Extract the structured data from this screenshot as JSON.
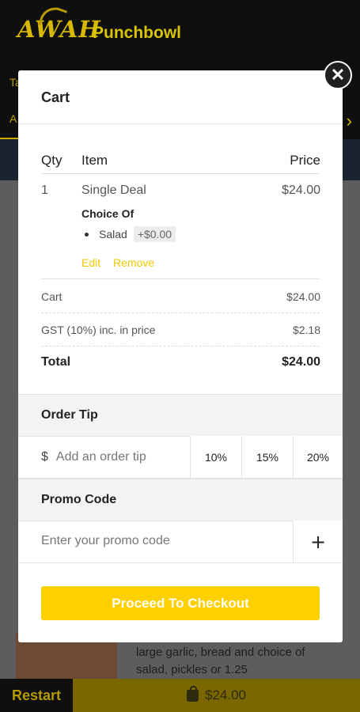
{
  "background": {
    "logo_text": "AWAH",
    "restaurant_name": "Punchbowl",
    "tab_1": "Ta",
    "tab_2": "A",
    "description": "large garlic, bread and choice of salad, pickles or 1.25",
    "restart_label": "Restart",
    "bottom_total": "$24.00"
  },
  "cart": {
    "title": "Cart",
    "columns": {
      "qty": "Qty",
      "item": "Item",
      "price": "Price"
    },
    "items": [
      {
        "qty": "1",
        "name": "Single Deal",
        "price": "$24.00",
        "choice_label": "Choice Of",
        "option": "Salad",
        "option_price": "+$0.00",
        "edit": "Edit",
        "remove": "Remove"
      }
    ],
    "summary": {
      "cart_label": "Cart",
      "cart_value": "$24.00",
      "gst_label": "GST (10%) inc. in price",
      "gst_value": "$2.18",
      "total_label": "Total",
      "total_value": "$24.00"
    },
    "tip": {
      "title": "Order Tip",
      "currency": "$",
      "placeholder": "Add an order tip",
      "options": [
        "10%",
        "15%",
        "20%"
      ]
    },
    "promo": {
      "title": "Promo Code",
      "placeholder": "Enter your promo code",
      "add_symbol": "+"
    },
    "checkout_label": "Proceed To Checkout",
    "close_symbol": "✕"
  },
  "colors": {
    "accent": "#ffd000",
    "link": "#f0c800",
    "overlay": "#5a5a5a"
  },
  "icons": [
    "close-icon",
    "chevron-right-icon",
    "bag-icon",
    "plus-icon"
  ]
}
